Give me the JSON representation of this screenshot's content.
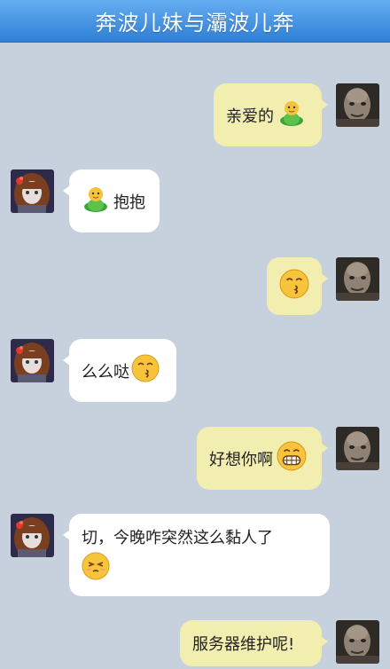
{
  "header": {
    "title": "奔波儿妹与灞波儿奔"
  },
  "messages": [
    {
      "side": "out",
      "text": "亲爱的",
      "emoji": "green-doll-icon"
    },
    {
      "side": "in",
      "text": "抱抱",
      "emoji": "green-doll-icon"
    },
    {
      "side": "out",
      "text": "",
      "emoji": "kiss-face-icon"
    },
    {
      "side": "in",
      "text": "么么哒",
      "emoji": "kiss-face-icon"
    },
    {
      "side": "out",
      "text": "好想你啊",
      "emoji": "grin-face-icon"
    },
    {
      "side": "in",
      "text": "切，今晚咋突然这么黏人了",
      "emoji": "squint-face-icon"
    },
    {
      "side": "out",
      "text": "服务器维护呢!",
      "emoji": ""
    }
  ],
  "colors": {
    "background": "#c7d1de",
    "header": "#3f8fe0",
    "outgoing_bubble": "#f2eeb0",
    "incoming_bubble": "#ffffff"
  }
}
